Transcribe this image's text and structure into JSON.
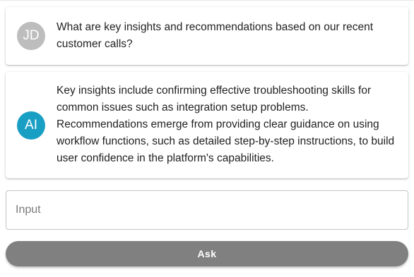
{
  "conversation": {
    "messages": [
      {
        "role": "user",
        "avatar_initials": "JD",
        "text": "What are key insights and recommendations based on our recent customer calls?"
      },
      {
        "role": "assistant",
        "avatar_initials": "AI",
        "text": "Key insights include confirming effective troubleshooting skills for common issues such as integration setup problems. Recommendations emerge from providing clear guidance on using workflow functions, such as detailed step-by-step instructions, to build user confidence in the platform's capabilities."
      }
    ]
  },
  "composer": {
    "input_placeholder": "Input",
    "input_value": "",
    "ask_label": "Ask"
  },
  "colors": {
    "user_avatar": "#bdbdbd",
    "ai_avatar": "#1a9fc4",
    "ask_button": "#808080"
  }
}
